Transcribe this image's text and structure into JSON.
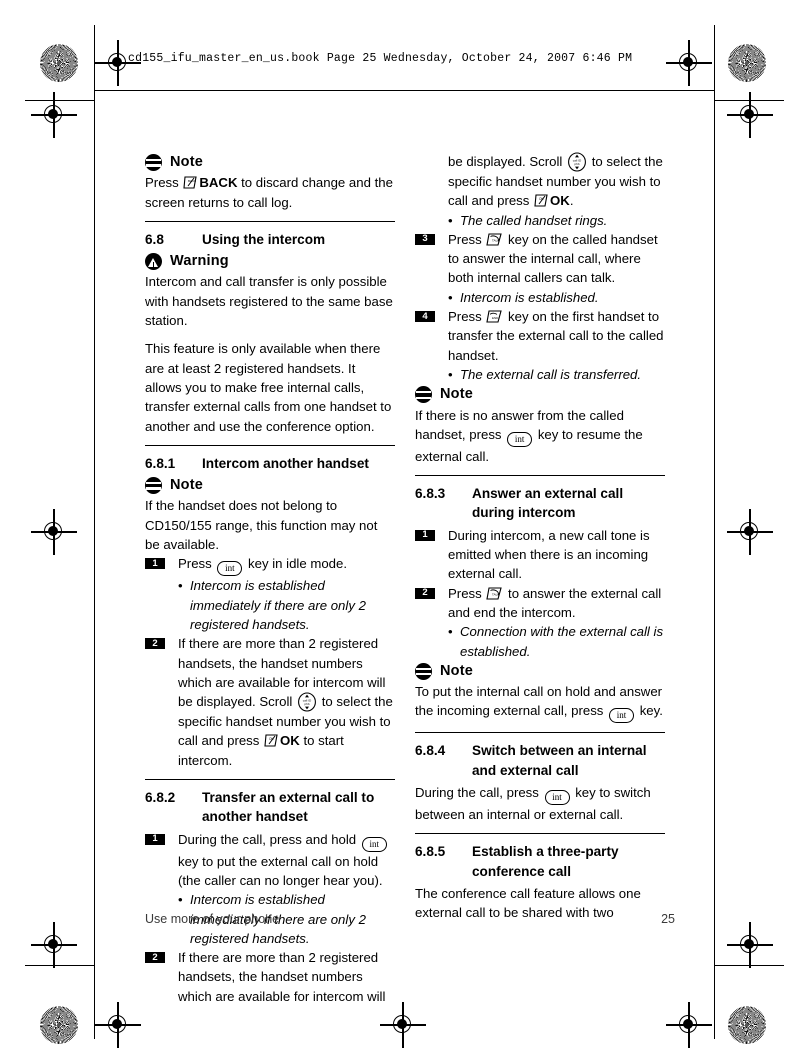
{
  "header": {
    "file_line": "cd155_ifu_master_en_us.book  Page 25  Wednesday, October 24, 2007  6:46 PM"
  },
  "footer": {
    "chapter": "Use more of your phone",
    "page_number": "25"
  },
  "icons": {
    "note": "note-icon",
    "warning": "warning-icon",
    "int_key": "int",
    "back_key": "back-softkey-icon",
    "ok_key": "ok-softkey-icon",
    "talk_key": "talk-key-icon",
    "end_key": "end-key-icon",
    "scroll_key": "scroll-navigation-key-icon"
  },
  "left_column": {
    "note1": {
      "title": "Note",
      "text_before_icon": "Press ",
      "bold_label": "BACK",
      "text_after": " to discard change and the screen returns to call log."
    },
    "section_68": {
      "number": "6.8",
      "title": "Using the intercom"
    },
    "warning": {
      "title": "Warning",
      "text": "Intercom and call transfer is only possible with handsets registered to the same base station."
    },
    "intro_para": "This feature is only available when there are at least 2 registered handsets. It allows you to make free internal calls, transfer external calls from one handset to another and use the conference option.",
    "section_681": {
      "number": "6.8.1",
      "title": "Intercom another handset"
    },
    "note2": {
      "title": "Note",
      "text": "If the handset does not belong to CD150/155 range, this function may not be available."
    },
    "step1": {
      "num": "1",
      "text_before": "Press ",
      "text_after": " key in idle mode.",
      "bullet": "Intercom is established immediately if there are only 2 registered handsets."
    },
    "step2": {
      "num": "2",
      "part1": "If there are more than 2 registered handsets, the handset numbers which are available for intercom will be displayed. Scroll ",
      "part2": " to select the specific handset number you wish to call and press ",
      "bold_label": "OK",
      "part3": " to start intercom."
    },
    "section_682": {
      "number": "6.8.2",
      "title_line1": "Transfer an external call to",
      "title_line2": "another handset"
    },
    "step682_1": {
      "num": "1",
      "text_before": "During the call, press and hold ",
      "text_after": " key to put the external call on hold (the caller can no longer hear you).",
      "bullet": "Intercom is established immediately if there are only 2 registered handsets."
    },
    "step682_2": {
      "num": "2",
      "text": "If there are more than 2 registered handsets, the handset numbers which are available for intercom will"
    }
  },
  "right_column": {
    "step682_2_cont": {
      "part1": "be displayed. Scroll ",
      "part2": " to select the specific handset number you wish to call and press ",
      "bold_label": "OK",
      "part3": ".",
      "bullet": "The called handset rings."
    },
    "step682_3": {
      "num": "3",
      "text_before": "Press ",
      "text_after": " key on the called handset to answer the internal call, where both internal callers can talk.",
      "bullet": "Intercom is established."
    },
    "step682_4": {
      "num": "4",
      "text_before": "Press ",
      "text_after": " key on the first handset to transfer the external call to the called handset.",
      "bullet": "The external call is transferred."
    },
    "note3": {
      "title": "Note",
      "text_before": "If there is no answer from the called handset, press ",
      "text_after": " key to resume the external call."
    },
    "section_683": {
      "number": "6.8.3",
      "title_line1": "Answer an external call",
      "title_line2": "during intercom"
    },
    "step683_1": {
      "num": "1",
      "text": "During intercom, a new call tone is emitted when there is an incoming external call."
    },
    "step683_2": {
      "num": "2",
      "text_before": "Press ",
      "text_after": " to answer the external call and end the intercom.",
      "bullet": "Connection with the external call is established."
    },
    "note4": {
      "title": "Note",
      "text_before": "To put the internal call on hold and answer the incoming external call, press ",
      "text_after": " key."
    },
    "section_684": {
      "number": "6.8.4",
      "title_line1": "Switch between an internal",
      "title_line2": "and external call",
      "text_before": "During the call, press ",
      "text_after": " key to switch between an internal or external call."
    },
    "section_685": {
      "number": "6.8.5",
      "title_line1": "Establish a three-party",
      "title_line2": "conference call",
      "text": "The conference call feature allows one external call to be shared with two"
    }
  }
}
